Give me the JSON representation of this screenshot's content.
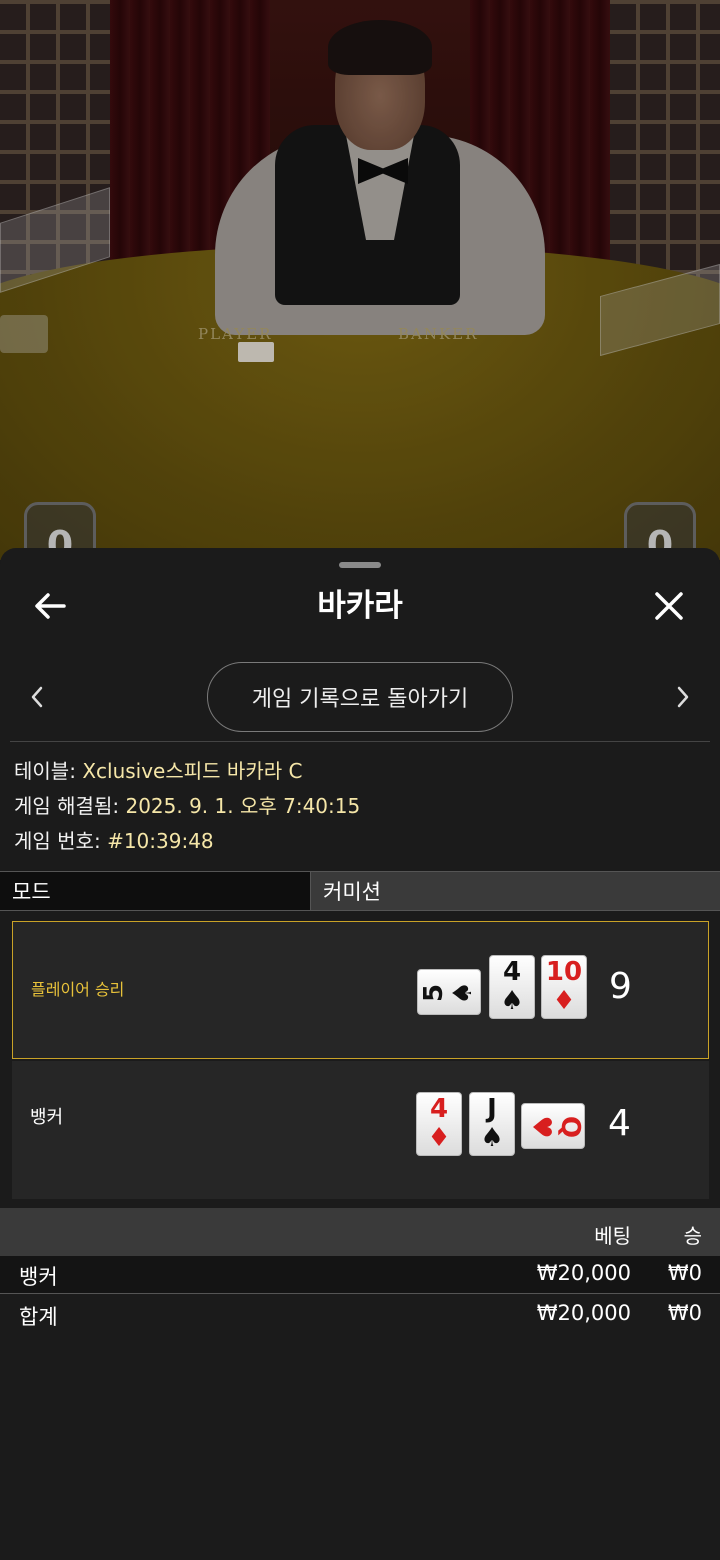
{
  "video": {
    "felt_player_label": "PLAYER",
    "felt_banker_label": "BANKER",
    "player_score": "0",
    "banker_score": "0"
  },
  "header": {
    "title": "바카라",
    "back_icon": "arrow-left-icon",
    "close_icon": "close-icon"
  },
  "nav": {
    "history_button": "게임 기록으로 돌아가기",
    "prev_icon": "chevron-left-icon",
    "next_icon": "chevron-right-icon"
  },
  "info": {
    "table_label": "테이블:",
    "table_value": "Xclusive스피드 바카라 C",
    "resolved_label": "게임 해결됨:",
    "resolved_value": "2025. 9. 1. 오후 7:40:15",
    "round_label": "게임 번호:",
    "round_value": "#10:39:48"
  },
  "tabs": {
    "mode": "모드",
    "commission": "커미션"
  },
  "hands": {
    "player": {
      "label": "플레이어 승리",
      "total": "9",
      "cards": [
        {
          "rank": "5",
          "suit": "♠",
          "color": "#111111",
          "rotated": true
        },
        {
          "rank": "4",
          "suit": "♠",
          "color": "#111111",
          "rotated": false
        },
        {
          "rank": "10",
          "suit": "♦",
          "color": "#d81f1f",
          "rotated": false
        }
      ]
    },
    "banker": {
      "label": "뱅커",
      "total": "4",
      "cards": [
        {
          "rank": "4",
          "suit": "♦",
          "color": "#d81f1f",
          "rotated": false
        },
        {
          "rank": "J",
          "suit": "♠",
          "color": "#111111",
          "rotated": false
        },
        {
          "rank": "Q",
          "suit": "♥",
          "color": "#d81f1f",
          "rotated": true
        }
      ]
    }
  },
  "bets": {
    "col_bet": "베팅",
    "col_win": "승",
    "rows": [
      {
        "name": "뱅커",
        "bet": "₩20,000",
        "win": "₩0"
      }
    ],
    "total": {
      "name": "합계",
      "bet": "₩20,000",
      "win": "₩0"
    }
  },
  "colors": {
    "accent_gold": "#c9a227",
    "winner_text": "#e8c23a",
    "info_value": "#f5e6a8",
    "sheet_bg": "#1b1b1b"
  }
}
